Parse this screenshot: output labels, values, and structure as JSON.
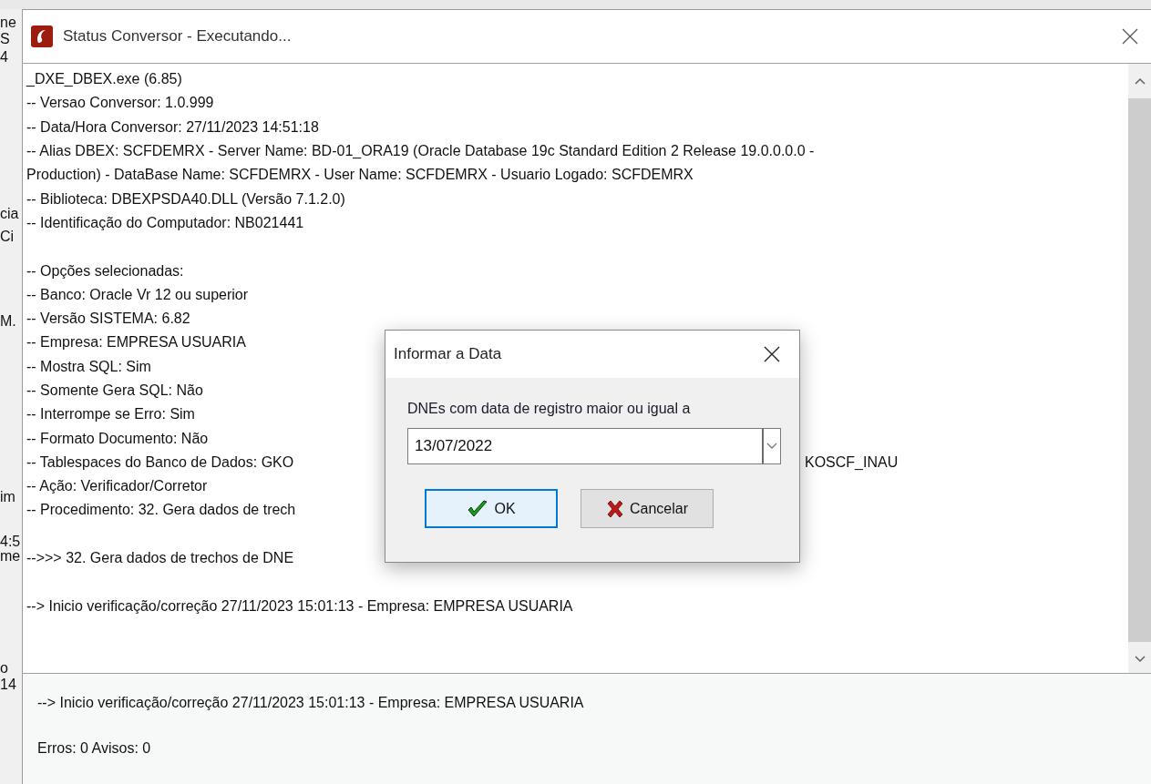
{
  "background_window": {
    "fragments": [
      "ne",
      "S",
      "4",
      "cia",
      "Ci",
      "M.",
      "im",
      "4:5",
      "me",
      "o",
      "14"
    ]
  },
  "window": {
    "title": "Status Conversor - Executando..."
  },
  "log": {
    "lines": [
      {
        "kind": "text",
        "text": "_DXE_DBEX.exe (6.85)"
      },
      {
        "kind": "text",
        "text": "-- Versao Conversor: 1.0.999"
      },
      {
        "kind": "text",
        "text": "-- Data/Hora Conversor: 27/11/2023 14:51:18"
      },
      {
        "kind": "text",
        "text": "-- Alias DBEX: SCFDEMRX - Server Name: BD-01_ORA19 (Oracle Database 19c Standard Edition 2 Release 19.0.0.0.0 -"
      },
      {
        "kind": "text",
        "text": "Production) - DataBase Name: SCFDEMRX - User Name: SCFDEMRX - Usuario Logado: SCFDEMRX"
      },
      {
        "kind": "text",
        "text": "-- Biblioteca: DBEXPSDA40.DLL (Versão 7.1.2.0)"
      },
      {
        "kind": "text",
        "text": "-- Identificação do Computador: NB021441"
      },
      {
        "kind": "blank"
      },
      {
        "kind": "text",
        "text": "-- Opções selecionadas:"
      },
      {
        "kind": "text",
        "text": "-- Banco: Oracle Vr 12 ou superior"
      },
      {
        "kind": "text",
        "text": "-- Versão SISTEMA: 6.82"
      },
      {
        "kind": "text",
        "text": "-- Empresa: EMPRESA USUARIA"
      },
      {
        "kind": "text",
        "text": "-- Mostra SQL: Sim"
      },
      {
        "kind": "text",
        "text": "-- Somente Gera SQL: Não"
      },
      {
        "kind": "text",
        "text": "-- Interrompe se Erro: Sim"
      },
      {
        "kind": "text",
        "text": "-- Formato Documento: Não"
      },
      {
        "kind": "text",
        "text": "-- Tablespaces do Banco de Dados: GKO",
        "text_right": "KOSCF_INAU"
      },
      {
        "kind": "text",
        "text": "-- Ação: Verificador/Corretor"
      },
      {
        "kind": "text",
        "text": "-- Procedimento: 32. Gera dados de trech"
      },
      {
        "kind": "blank"
      },
      {
        "kind": "text",
        "text": "-->>> 32. Gera dados de trechos de DNE"
      },
      {
        "kind": "blank"
      },
      {
        "kind": "text",
        "text": "--> Inicio verificação/correção 27/11/2023 15:01:13 - Empresa: EMPRESA USUARIA"
      }
    ]
  },
  "status": {
    "lines": [
      "--> Inicio verificação/correção 27/11/2023 15:01:13 - Empresa: EMPRESA USUARIA",
      "Erros: 0 Avisos: 0"
    ]
  },
  "dialog": {
    "title": "Informar a Data",
    "label": "DNEs com data de registro maior ou igual a",
    "date_value": "13/07/2022",
    "buttons": [
      {
        "kind": "ok",
        "label": "OK",
        "selected": true
      },
      {
        "kind": "cancel",
        "label": "Cancelar",
        "selected": false
      }
    ]
  }
}
